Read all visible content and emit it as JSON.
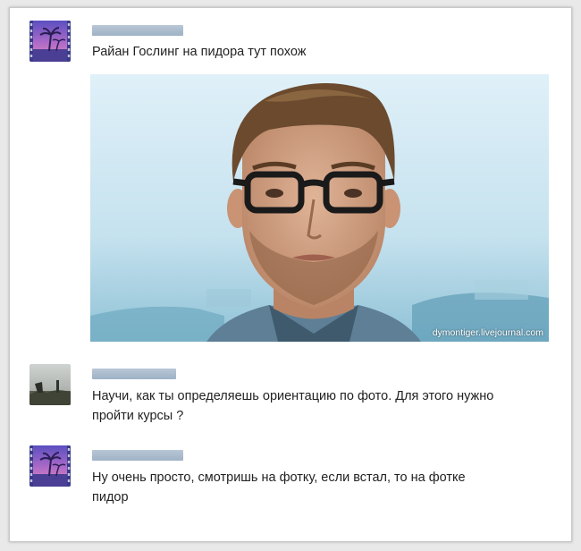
{
  "comments": [
    {
      "author_redacted": true,
      "avatar": "palm-tree-sunset-avatar",
      "text": "Райан Гослинг на пидора тут похож",
      "attachment": {
        "type": "photo",
        "subject": "man with glasses portrait",
        "watermark": "dymontiger.livejournal.com"
      }
    },
    {
      "author_redacted": true,
      "avatar": "statue-photo-avatar",
      "text_line1": "Научи, как ты определяешь ориентацию по фото. Для этого нужно",
      "text_line2": "пройти курсы ?"
    },
    {
      "author_redacted": true,
      "avatar": "palm-tree-sunset-avatar",
      "text_line1": "Ну очень просто, смотришь на фотку, если встал, то на фотке",
      "text_line2": "пидор"
    }
  ],
  "colors": {
    "text": "#222222",
    "name_redaction": "#a9bacb",
    "photo_sky": "#cfe6f2"
  }
}
